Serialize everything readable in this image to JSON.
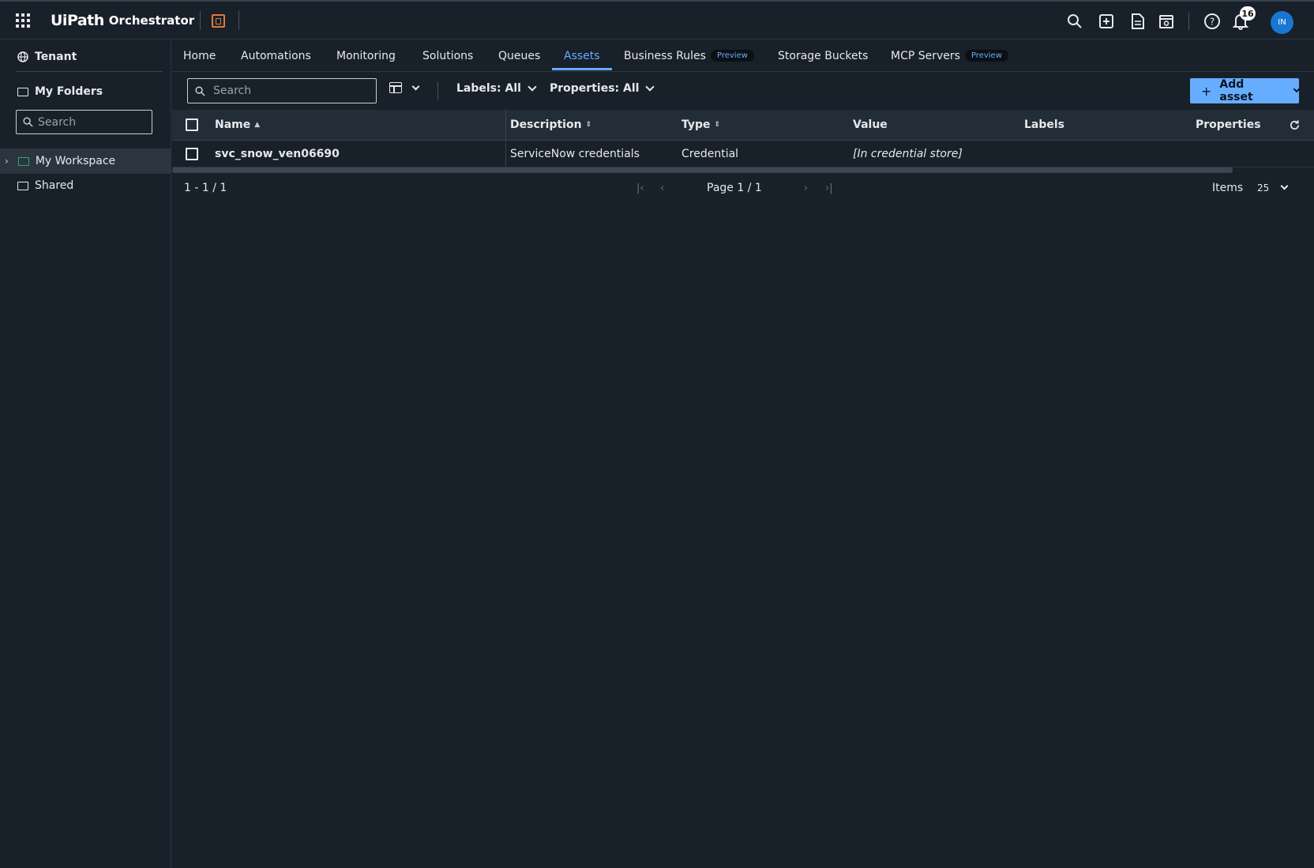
{
  "header": {
    "app_brand": "UiPath",
    "app_name": "Orchestrator",
    "notification_count": "16",
    "avatar_initials": "IN"
  },
  "sidebar": {
    "tenant_label": "Tenant",
    "folders_label": "My Folders",
    "search_placeholder": "Search",
    "items": [
      {
        "label": "My Workspace",
        "selected": true
      },
      {
        "label": "Shared",
        "selected": false
      }
    ]
  },
  "tabs": [
    {
      "label": "Home"
    },
    {
      "label": "Automations"
    },
    {
      "label": "Monitoring"
    },
    {
      "label": "Solutions"
    },
    {
      "label": "Queues"
    },
    {
      "label": "Assets",
      "active": true
    },
    {
      "label": "Business Rules",
      "badge": "Preview"
    },
    {
      "label": "Storage Buckets"
    },
    {
      "label": "MCP Servers",
      "badge": "Preview"
    }
  ],
  "toolbar": {
    "search_placeholder": "Search",
    "labels_filter": "Labels: All",
    "properties_filter": "Properties: All",
    "add_button": "Add asset"
  },
  "grid": {
    "columns": [
      "Name",
      "Description",
      "Type",
      "Value",
      "Labels",
      "Properties"
    ],
    "rows": [
      {
        "name": "svc_snow_ven06690",
        "description": "ServiceNow credentials",
        "type": "Credential",
        "value": "[In credential store]",
        "labels": "",
        "properties": ""
      }
    ]
  },
  "pager": {
    "range": "1 - 1 / 1",
    "page": "Page 1 / 1",
    "items_label": "Items",
    "page_size": "25"
  },
  "colors": {
    "background": "#182029",
    "accent": "#66adff",
    "tenant_icon": "#e07b39",
    "workspace_folder": "#38a169"
  }
}
